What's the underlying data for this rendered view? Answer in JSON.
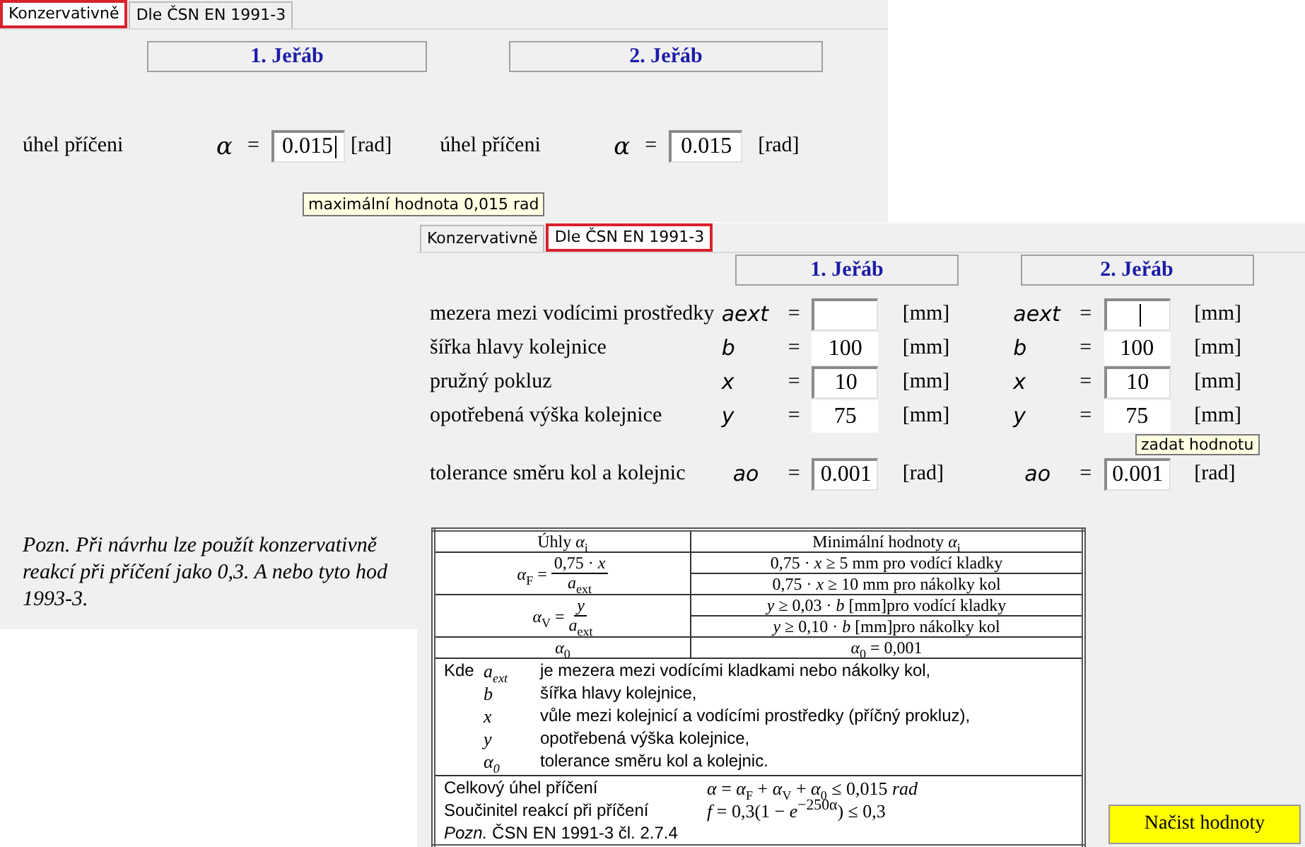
{
  "conservative_view": {
    "tabs": [
      {
        "label": "Konzervativně",
        "selected": true,
        "highlighted": true
      },
      {
        "label": "Dle ČSN EN 1991-3",
        "selected": false,
        "highlighted": false
      }
    ],
    "cranes": [
      {
        "title": "1. Jeřáb",
        "label": "úhel příčeni",
        "symbol": "α",
        "equals": "=",
        "value": "0.015",
        "unit": "[rad]",
        "focused": true
      },
      {
        "title": "2. Jeřáb",
        "label": "úhel příčeni",
        "symbol": "α",
        "equals": "=",
        "value": "0.015",
        "unit": "[rad]",
        "focused": false
      }
    ],
    "tooltip": "maximální hodnota 0,015 rad",
    "note_lines": [
      "Pozn. Při návrhu lze použít konzervativně",
      "reakcí při příčení jako 0,3. A nebo tyto hod",
      "1993-3."
    ]
  },
  "standard_view": {
    "tabs": [
      {
        "label": "Konzervativně",
        "selected": false,
        "highlighted": false
      },
      {
        "label": "Dle ČSN EN 1991-3",
        "selected": true,
        "highlighted": true
      }
    ],
    "cranes": [
      {
        "title": "1. Jeřáb"
      },
      {
        "title": "2. Jeřáb"
      }
    ],
    "rows": [
      {
        "kind": "input",
        "label": "mezera mezi vodícimi prostředky",
        "cells": [
          {
            "symbol": "aext",
            "equals": "=",
            "editable": true,
            "focused": false,
            "unit": "[mm]"
          },
          {
            "symbol": "aext",
            "equals": "=",
            "editable": true,
            "focused": true,
            "unit": "[mm]"
          }
        ]
      },
      {
        "kind": "input",
        "label": "šířka hlavy kolejnice",
        "cells": [
          {
            "symbol": "b",
            "equals": "=",
            "value": "100",
            "editable": false,
            "focused": false,
            "unit": "[mm]"
          },
          {
            "symbol": "b",
            "equals": "=",
            "value": "100",
            "editable": false,
            "focused": false,
            "unit": "[mm]"
          }
        ]
      },
      {
        "kind": "input",
        "label": "pružný pokluz",
        "cells": [
          {
            "symbol": "x",
            "equals": "=",
            "value": "10",
            "editable": true,
            "focused": false,
            "unit": "[mm]"
          },
          {
            "symbol": "x",
            "equals": "=",
            "value": "10",
            "editable": true,
            "focused": false,
            "unit": "[mm]"
          }
        ]
      },
      {
        "kind": "input",
        "label": "opotřebená výška kolejnice",
        "cells": [
          {
            "symbol": "y",
            "equals": "=",
            "value": "75",
            "editable": false,
            "focused": false,
            "unit": "[mm]"
          },
          {
            "symbol": "y",
            "equals": "=",
            "value": "75",
            "editable": false,
            "focused": false,
            "unit": "[mm]"
          }
        ]
      },
      {
        "kind": "spaced",
        "label": "tolerance směru kol a kolejnic",
        "cells": [
          {
            "symbol": "ao",
            "equals": "=",
            "value": "0.001",
            "editable": true,
            "focused": false,
            "unit": "[rad]"
          },
          {
            "symbol": "ao",
            "equals": "=",
            "value": "0.001",
            "editable": true,
            "focused": false,
            "unit": "[rad]"
          }
        ]
      }
    ],
    "tooltip": "zadat hodnotu",
    "table": {
      "columns": [
        "Úhly  *α*$_{i}$",
        "Minimální hodnoty *α*$_{i}$"
      ],
      "rows": [
        {
          "lhs": "*α*$_{F}$ =",
          "numerator": "0,75 · *x*",
          "denominator": "*a*$_{ext}$",
          "values": [
            "0,75 · *x* ≥ 5 mm pro vodící kladky",
            "0,75 · *x* ≥ 10 mm pro nákolky kol"
          ]
        },
        {
          "lhs": "*α*$_{V}$ =",
          "numerator": "*y*",
          "denominator": "*a*$_{ext}$",
          "values": [
            "*y* ≥ 0,03 · *b* [mm]pro vodící kladky",
            "*y* ≥ 0,10 · *b* [mm]pro nákolky kol"
          ]
        },
        {
          "lhs": "*α*$_{0}$",
          "values": [
            "*α*$_{0}$ = 0,001"
          ]
        }
      ],
      "legend_lead": "Kde",
      "legend": [
        {
          "symbol": "*a*$_{ext}$",
          "text": "je  mezera mezi vodícími kladkami nebo nákolky kol,"
        },
        {
          "symbol": "*b*",
          "text": "šířka hlavy kolejnice,"
        },
        {
          "symbol": "*x*",
          "text": "vůle mezi kolejnicí a vodícími prostředky (příčný prokluz),"
        },
        {
          "symbol": "*y*",
          "text": "opotřebená výška kolejnice,"
        },
        {
          "symbol": "*α*$_{0}$",
          "text": "tolerance směru kol a kolejnic."
        }
      ],
      "totals": [
        {
          "label": "Celkový úhel příčení",
          "formula": "*α* = *α*$_{F}$ + *α*$_{V}$ + *α*$_{0}$ ≤ 0,015 *rad*"
        },
        {
          "label": "Součinitel reakcí při příčení",
          "formula": "*f* = 0,3(1 − *e*$^{−250α}$) ≤ 0,3"
        }
      ],
      "note": "*Pozn.* ČSN EN 1991-3 čl. 2.7.4"
    },
    "button": "Načist hodnoty"
  }
}
